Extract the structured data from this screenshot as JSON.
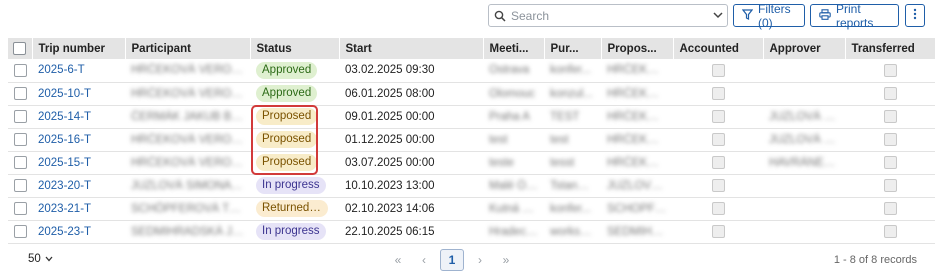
{
  "toolbar": {
    "search_placeholder": "Search",
    "filters_label": "Filters (0)",
    "print_label": "Print reports"
  },
  "table": {
    "columns": [
      "Trip number",
      "Participant",
      "Status",
      "Start",
      "Meeti...",
      "Pur...",
      "Propos...",
      "Accounted",
      "Approver",
      "Transferred"
    ],
    "rows": [
      {
        "trip": "2025-6-T",
        "participant": "HRČEKOVÁ VERONIKA I...",
        "status": "Approved",
        "status_kind": "approved",
        "start": "03.02.2025 09:30",
        "meeting": "Ostrava",
        "purpose": "konfer...",
        "proposer": "HRČEKOVÁ VER...",
        "approver": ""
      },
      {
        "trip": "2025-10-T",
        "participant": "HRČEKOVÁ VERONIKA I...",
        "status": "Approved",
        "status_kind": "approved",
        "start": "06.01.2025 08:00",
        "meeting": "Olomouc",
        "purpose": "konzul...",
        "proposer": "HRČEKOVÁ VER...",
        "approver": ""
      },
      {
        "trip": "2025-14-T",
        "participant": "ČERMÁK JAKUB Bc. ...",
        "status": "Proposed",
        "status_kind": "proposed",
        "start": "09.01.2025 00:00",
        "meeting": "Praha A",
        "purpose": "TEST",
        "proposer": "HRČEKOVÁ VER...",
        "approver": "JUZLOVÁ SIM..."
      },
      {
        "trip": "2025-16-T",
        "participant": "HRČEKOVÁ VERONIKA I...",
        "status": "Proposed",
        "status_kind": "proposed",
        "start": "01.12.2025 00:00",
        "meeting": "test",
        "purpose": "test",
        "proposer": "HRČEKOVÁ VER...",
        "approver": "JUZLOVÁ SIM..."
      },
      {
        "trip": "2025-15-T",
        "participant": "HRČEKOVÁ VERONIKA I...",
        "status": "Proposed",
        "status_kind": "proposed",
        "start": "03.07.2025 00:00",
        "meeting": "teste",
        "purpose": "tesst",
        "proposer": "HRČEKOVÁ VER...",
        "approver": "HAVRÁNEK ..."
      },
      {
        "trip": "2023-20-T",
        "participant": "JUZLOVÁ SIMONA JUDr...",
        "status": "In progress",
        "status_kind": "progress",
        "start": "10.10.2023 13:00",
        "meeting": "Malé Ópa",
        "purpose": "Tstaněk...",
        "proposer": "JUZLOVÁ SIM...",
        "approver": ""
      },
      {
        "trip": "2023-21-T",
        "participant": "SCHÖPFEROVÁ TERE...",
        "status": "Returned f...",
        "status_kind": "returned",
        "start": "02.10.2023 14:06",
        "meeting": "Kutná H...",
        "purpose": "konfer...",
        "proposer": "SCHÖPFERO...",
        "approver": ""
      },
      {
        "trip": "2025-23-T",
        "participant": "SEDMIHRADSKÁ JARMI...",
        "status": "In progress",
        "status_kind": "progress",
        "start": "22.10.2025 06:15",
        "meeting": "Hradec K...",
        "purpose": "worksh...",
        "proposer": "SEDMIHRA...",
        "approver": ""
      }
    ]
  },
  "footer": {
    "page_size": "50",
    "current_page": "1",
    "records_text": "1 - 8 of 8 records"
  },
  "colors": {
    "accent": "#1f5ea8",
    "header_bg": "#e4e4e4",
    "highlight": "#d23a3a"
  }
}
